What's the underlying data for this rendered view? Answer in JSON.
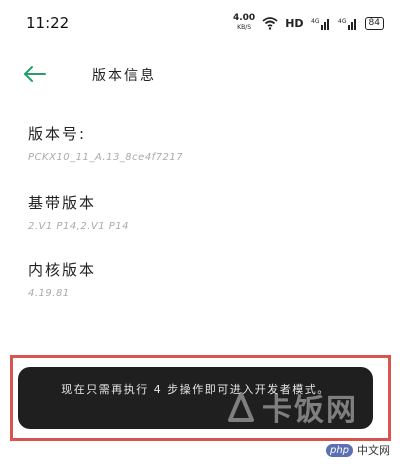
{
  "status_bar": {
    "time": "11:22",
    "speed_value": "4.00",
    "speed_unit": "KB/S",
    "hd_label": "HD",
    "network_1": "4G",
    "network_2": "4G",
    "battery": "84"
  },
  "header": {
    "title": "版本信息"
  },
  "items": {
    "version": {
      "label": "版本号:",
      "value": "PCKX10_11_A.13_8ce4f7217"
    },
    "baseband": {
      "label": "基带版本",
      "value": "2.V1 P14,2.V1 P14"
    },
    "kernel": {
      "label": "内核版本",
      "value": "4.19.81"
    }
  },
  "toast": {
    "message": "现在只需再执行 4 步操作即可进入开发者模式。"
  },
  "watermarks": {
    "site_text": "卡饭网",
    "php_badge": "php",
    "php_text": "中文网"
  },
  "colors": {
    "accent": "#26a06a",
    "highlight_border": "#d9534f",
    "toast_bg": "#1f1f1f"
  },
  "icons": [
    "wifi-icon",
    "signal-icon",
    "battery-icon",
    "back-arrow-icon"
  ]
}
